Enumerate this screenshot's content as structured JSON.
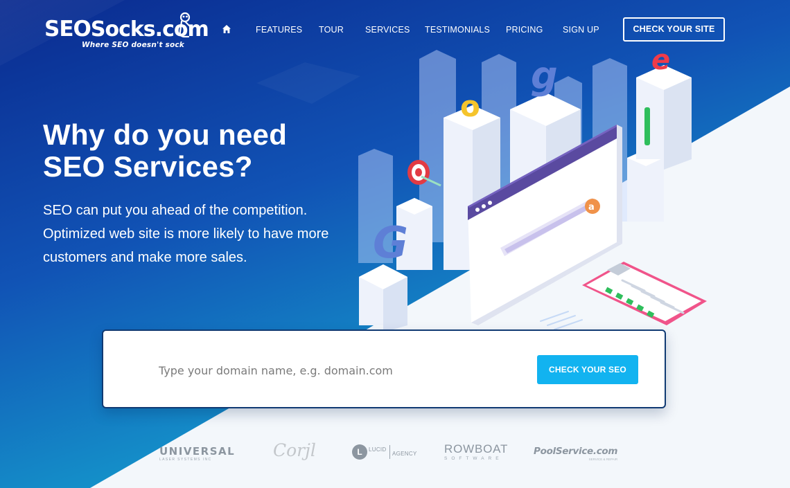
{
  "colors": {
    "bg_top": "#0a2a8f",
    "bg_mid": "#1156b8",
    "bg_bottom": "#14a6cf",
    "accent_button": "#12b3f0",
    "card_border": "#103a73",
    "page_light": "#f3f7fb"
  },
  "brand": {
    "name_part1": "SEO",
    "name_part2": "Socks.com",
    "tagline": "Where SEO doesn't sock",
    "mascot_icon": "sock-mascot-icon"
  },
  "nav": {
    "home_icon": "home-icon",
    "items": [
      "FEATURES",
      "TOUR",
      "SERVICES",
      "TESTIMONIALS",
      "PRICING",
      "SIGN UP"
    ],
    "cta_label": "CHECK YOUR SITE"
  },
  "hero": {
    "title_line1": "Why do you need",
    "title_line2": "SEO Services?",
    "subtitle_line1": "SEO can put you ahead of the competition.",
    "subtitle_line2": "Optimized web site is more likely to have more",
    "subtitle_line3": "customers and make more sales."
  },
  "illustration": {
    "letters": [
      "G",
      "o",
      "g",
      "l",
      "e"
    ],
    "target_icon": "target-icon",
    "browser_icon": "browser-window-icon",
    "at_icon": "at-sign-icon",
    "clipboard_icon": "checklist-clipboard-icon"
  },
  "search": {
    "placeholder": "Type your domain name, e.g. domain.com",
    "value": "",
    "button_label": "CHECK YOUR SEO"
  },
  "clients": {
    "universal": {
      "name": "UNIVERSAL",
      "sub": "LASER SYSTEMS INC"
    },
    "corjl": {
      "name": "Corjl"
    },
    "lucid": {
      "mark": "L",
      "name": "LUCID",
      "sub": "AGENCY"
    },
    "rowboat": {
      "name": "ROWBOAT",
      "sub": "SOFTWARE"
    },
    "poolservice": {
      "name": "PoolService.com",
      "sub": "SERVICE & REPAIR"
    }
  }
}
